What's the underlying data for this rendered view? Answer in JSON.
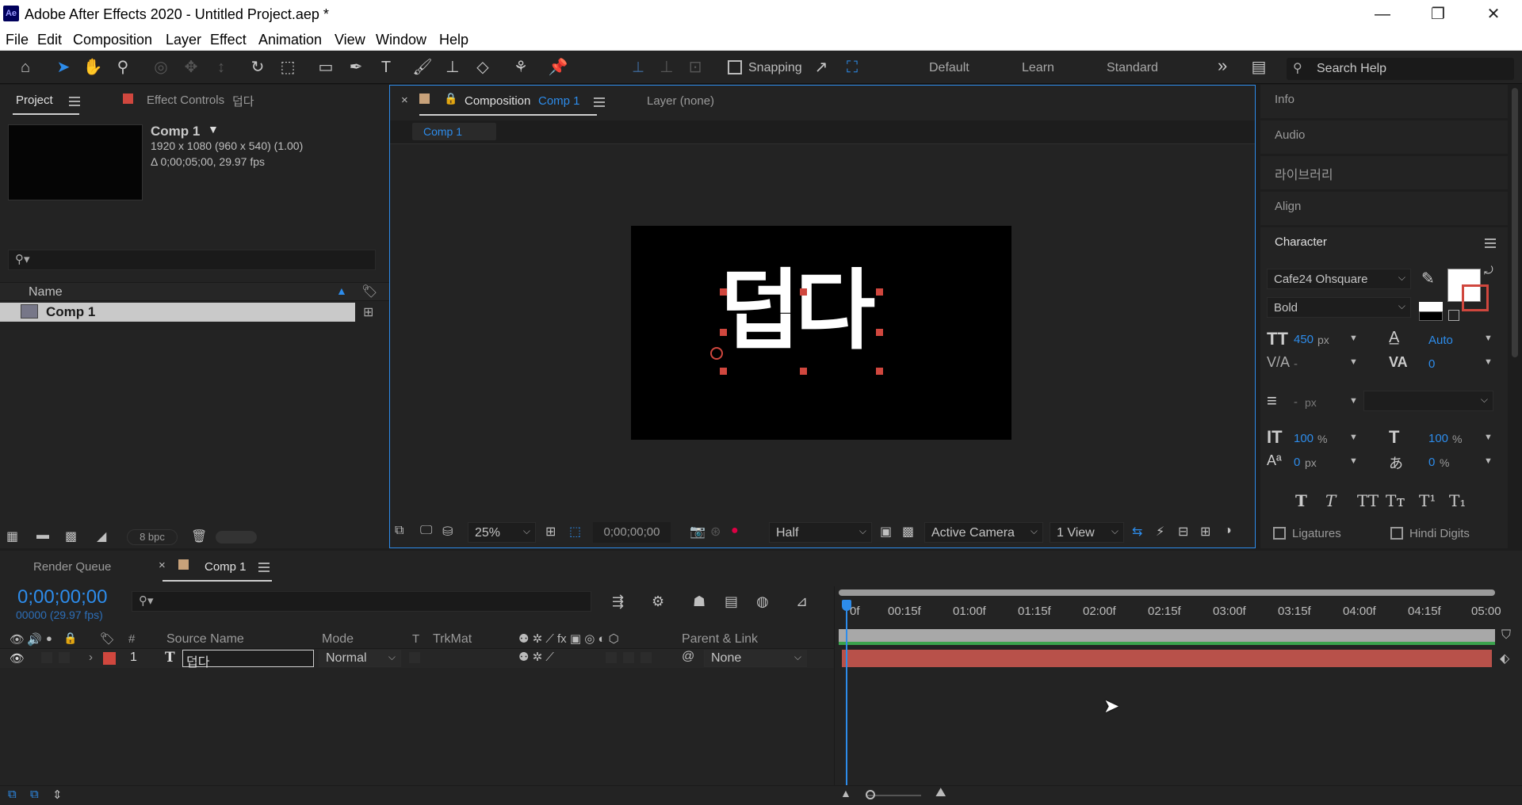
{
  "window": {
    "logo": "Ae",
    "title": "Adobe After Effects 2020 - Untitled Project.aep *",
    "min": "—",
    "restore": "❐",
    "close": "✕"
  },
  "menu": [
    "File",
    "Edit",
    "Composition",
    "Layer",
    "Effect",
    "Animation",
    "View",
    "Window",
    "Help"
  ],
  "toolbar": {
    "snapping": "Snapping",
    "workspaces": [
      "Default",
      "Learn",
      "Standard"
    ],
    "more": "»",
    "search_placeholder": "Search Help"
  },
  "project_panel": {
    "tab": "Project",
    "effect_controls": "Effect Controls",
    "effect_controls_target": "덥다",
    "comp_name": "Comp 1",
    "comp_res": "1920 x 1080  (960 x 540) (1.00)",
    "comp_duration": "Δ 0;00;05;00, 29.97 fps",
    "col_name": "Name",
    "items": [
      {
        "name": "Comp 1"
      }
    ],
    "bpc": "8 bpc"
  },
  "comp_panel": {
    "tab_prefix": "Composition",
    "tab_comp": "Comp 1",
    "layer_tab": "Layer (none)",
    "sub_tab": "Comp 1",
    "preview_text": "덥다",
    "zoom": "25%",
    "timecode": "0;00;00;00",
    "resolution": "Half",
    "camera": "Active Camera",
    "views": "1 View"
  },
  "right_panels": {
    "info": "Info",
    "audio": "Audio",
    "library": "라이브러리",
    "align": "Align",
    "character": "Character"
  },
  "character": {
    "font": "Cafe24 Ohsquare",
    "style": "Bold",
    "size": "450",
    "size_unit": "px",
    "leading": "Auto",
    "kerning": "-",
    "tracking": "0",
    "stroke_width": "-",
    "stroke_unit": "px",
    "vscale": "100",
    "vscale_unit": "%",
    "hscale": "100",
    "hscale_unit": "%",
    "baseline": "0",
    "baseline_unit": "px",
    "tsume": "0",
    "tsume_unit": "%",
    "style_buttons": [
      "T",
      "T",
      "TT",
      "Tт",
      "T¹",
      "T₁"
    ],
    "ligatures": "Ligatures",
    "hindi_digits": "Hindi Digits"
  },
  "timeline": {
    "render_queue": "Render Queue",
    "comp_tab": "Comp 1",
    "timecode": "0;00;00;00",
    "frames": "00000 (29.97 fps)",
    "columns": {
      "num": "#",
      "source": "Source Name",
      "mode": "Mode",
      "t": "T",
      "trkmat": "TrkMat",
      "parent": "Parent & Link"
    },
    "layer": {
      "index": "1",
      "type_icon": "T",
      "name": "덥다",
      "mode": "Normal",
      "parent": "None"
    },
    "ruler_ticks": [
      "0f",
      "00:15f",
      "01:00f",
      "01:15f",
      "02:00f",
      "02:15f",
      "03:00f",
      "03:15f",
      "04:00f",
      "04:15f",
      "05:00"
    ]
  },
  "colors": {
    "accent": "#2d8ceb",
    "layer_bar": "#b8514a",
    "label_red": "#d0473e",
    "comp_swatch": "#c8a27a",
    "work_area_green": "#3ba34d"
  }
}
